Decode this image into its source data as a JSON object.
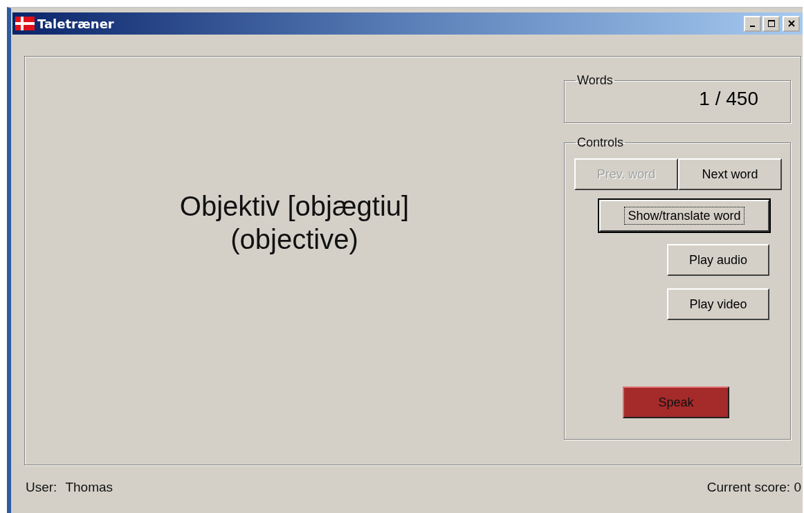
{
  "window": {
    "title": "Taletræner",
    "controls": [
      {
        "kind": "minimize"
      },
      {
        "kind": "maximize"
      },
      {
        "kind": "close"
      }
    ]
  },
  "word": {
    "lines": [
      "Objektiv [objægtiu]",
      "(objective)"
    ]
  },
  "words_group": {
    "title": "Words",
    "counter": "1 / 450"
  },
  "controls_group": {
    "title": "Controls",
    "buttons": [
      {
        "label": "Prev. word",
        "disabled": true,
        "focused": false,
        "kind": "pair"
      },
      {
        "label": "Next word",
        "disabled": false,
        "focused": false,
        "kind": "pair"
      },
      {
        "label": "Show/translate word",
        "disabled": false,
        "focused": true,
        "kind": "wide"
      },
      {
        "label": "Play audio",
        "disabled": false,
        "focused": false,
        "kind": "normal"
      },
      {
        "label": "Play video",
        "disabled": false,
        "focused": false,
        "kind": "normal"
      },
      {
        "label": "Speak",
        "disabled": false,
        "focused": false,
        "kind": "accent"
      }
    ]
  },
  "status_bar": {
    "user_label": "User:",
    "user": "Thomas",
    "score": "Current score: 0"
  }
}
